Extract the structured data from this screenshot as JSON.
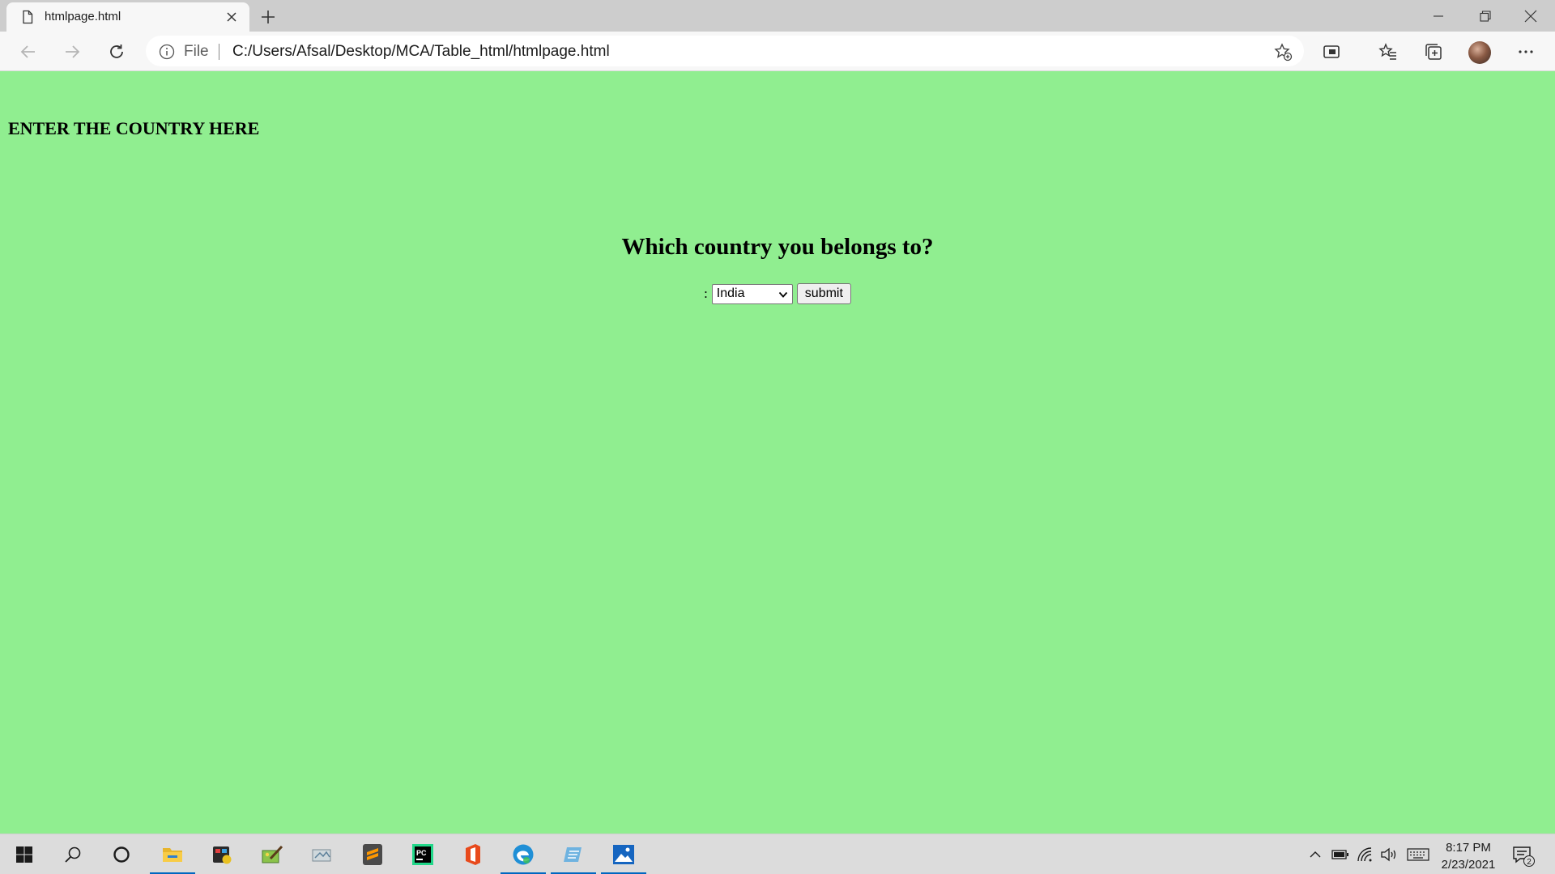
{
  "browser": {
    "tab": {
      "title": "htmlpage.html"
    },
    "address": {
      "scheme_label": "File",
      "url": "C:/Users/Afsal/Desktop/MCA/Table_html/htmlpage.html"
    }
  },
  "page": {
    "heading": "ENTER THE COUNTRY HERE",
    "question": "Which country you belongs to?",
    "form": {
      "prefix": ":",
      "country_selected": "India",
      "submit_label": "submit"
    }
  },
  "colors": {
    "page_background": "#90ee90",
    "taskbar_accent": "#0067c0"
  },
  "taskbar": {
    "apps": [
      "start-icon",
      "search-icon",
      "cortana-icon",
      "file-explorer-icon",
      "media-app-icon",
      "paint-app-icon",
      "snipping-app-icon",
      "sublime-text-icon",
      "pycharm-icon",
      "office-icon",
      "edge-icon",
      "notepad-app-icon",
      "photos-icon"
    ],
    "time": "8:17 PM",
    "date": "2/23/2021",
    "notification_count": "2"
  }
}
